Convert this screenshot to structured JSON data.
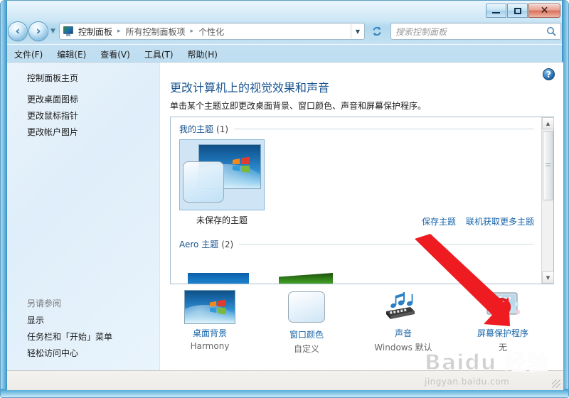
{
  "window": {
    "caption_buttons": {
      "minimize": "minimize-icon",
      "maximize": "maximize-icon",
      "close": "close-icon"
    }
  },
  "nav": {
    "back_icon": "back-arrow-icon",
    "forward_icon": "forward-arrow-icon",
    "recent_icon": "recent-pages-chevron-icon",
    "address_icon": "control-panel-monitor-icon",
    "breadcrumbs": [
      "控制面板",
      "所有控制面板项",
      "个性化"
    ],
    "separator": "▸",
    "dropdown_icon": "chevron-down-icon",
    "refresh_icon": "refresh-icon"
  },
  "search": {
    "placeholder": "搜索控制面板",
    "icon": "search-icon"
  },
  "menubar": {
    "items": [
      {
        "label": "文件(F)"
      },
      {
        "label": "编辑(E)"
      },
      {
        "label": "查看(V)"
      },
      {
        "label": "工具(T)"
      },
      {
        "label": "帮助(H)"
      }
    ]
  },
  "sidebar": {
    "home": "控制面板主页",
    "links": [
      "更改桌面图标",
      "更改鼠标指针",
      "更改帐户图片"
    ],
    "see_also_title": "另请参阅",
    "see_also": [
      "显示",
      "任务栏和「开始」菜单",
      "轻松访问中心"
    ]
  },
  "content": {
    "help_icon": "help-icon",
    "help_glyph": "?",
    "title": "更改计算机上的视觉效果和声音",
    "subtitle": "单击某个主题立即更改桌面背景、窗口颜色、声音和屏幕保护程序。",
    "groups": [
      {
        "label": "我的主题",
        "count": "(1)",
        "themes": [
          {
            "name": "未保存的主题",
            "selected": true
          }
        ]
      },
      {
        "label": "Aero 主题",
        "count": "(2)",
        "themes": []
      }
    ],
    "links": [
      {
        "label": "保存主题"
      },
      {
        "label": "联机获取更多主题"
      }
    ],
    "scrollbar": {
      "up_icon": "scroll-up-arrow-icon",
      "down_icon": "scroll-down-arrow-icon",
      "up_glyph": "▲",
      "down_glyph": "▼"
    }
  },
  "settings": [
    {
      "label": "桌面背景",
      "value": "Harmony",
      "icon": "desktop-background-icon"
    },
    {
      "label": "窗口颜色",
      "value": "自定义",
      "icon": "window-color-icon"
    },
    {
      "label": "声音",
      "value": "Windows 默认",
      "icon": "sound-icon"
    },
    {
      "label": "屏幕保护程序",
      "value": "无",
      "icon": "screensaver-disabled-icon"
    }
  ],
  "annotation": {
    "arrow_icon": "red-pointer-arrow",
    "color": "#ee1c20"
  },
  "watermark": {
    "main": "Baidu 经验",
    "sub": "jingyan.baidu.com"
  },
  "colors": {
    "link": "#1764a8",
    "title": "#19548f",
    "accent": "#2f8fc6"
  }
}
